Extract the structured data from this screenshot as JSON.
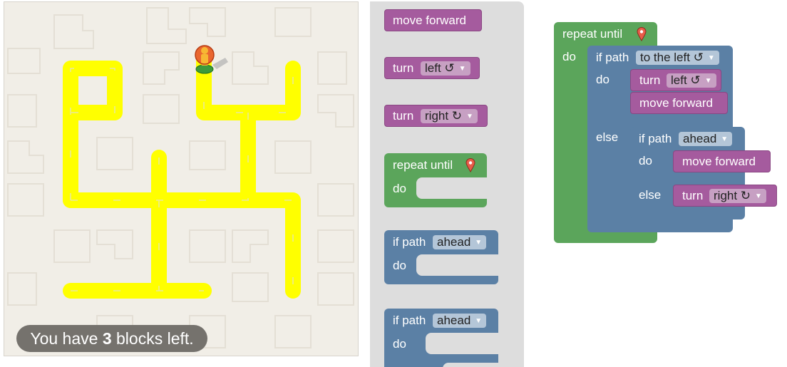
{
  "maze": {
    "blocks_left_prefix": "You have ",
    "blocks_left_count": "3",
    "blocks_left_suffix": " blocks left."
  },
  "toolbox": {
    "move_forward": "move forward",
    "turn": "turn",
    "left": "left ↺",
    "right": "right ↻",
    "repeat_until": "repeat until",
    "do": "do",
    "if_path": "if path",
    "ahead": "ahead"
  },
  "program": {
    "repeat_until": "repeat until",
    "do": "do",
    "if_path": "if path",
    "to_the_left": "to the left ↺",
    "turn": "turn",
    "left": "left ↺",
    "move_forward": "move forward",
    "else": "else",
    "ahead": "ahead",
    "right": "right ↻"
  },
  "colors": {
    "path": "#ffff00",
    "maze_bg": "#f1eee7",
    "movement_block": "#a55b9e",
    "loop_block": "#5ba55b",
    "logic_block": "#5b80a5",
    "toolbox_bg": "#dddddd"
  },
  "icons": {
    "pegman": "pegman-icon",
    "goal": "map-marker-icon",
    "dropdown": "triangle-down-icon"
  }
}
